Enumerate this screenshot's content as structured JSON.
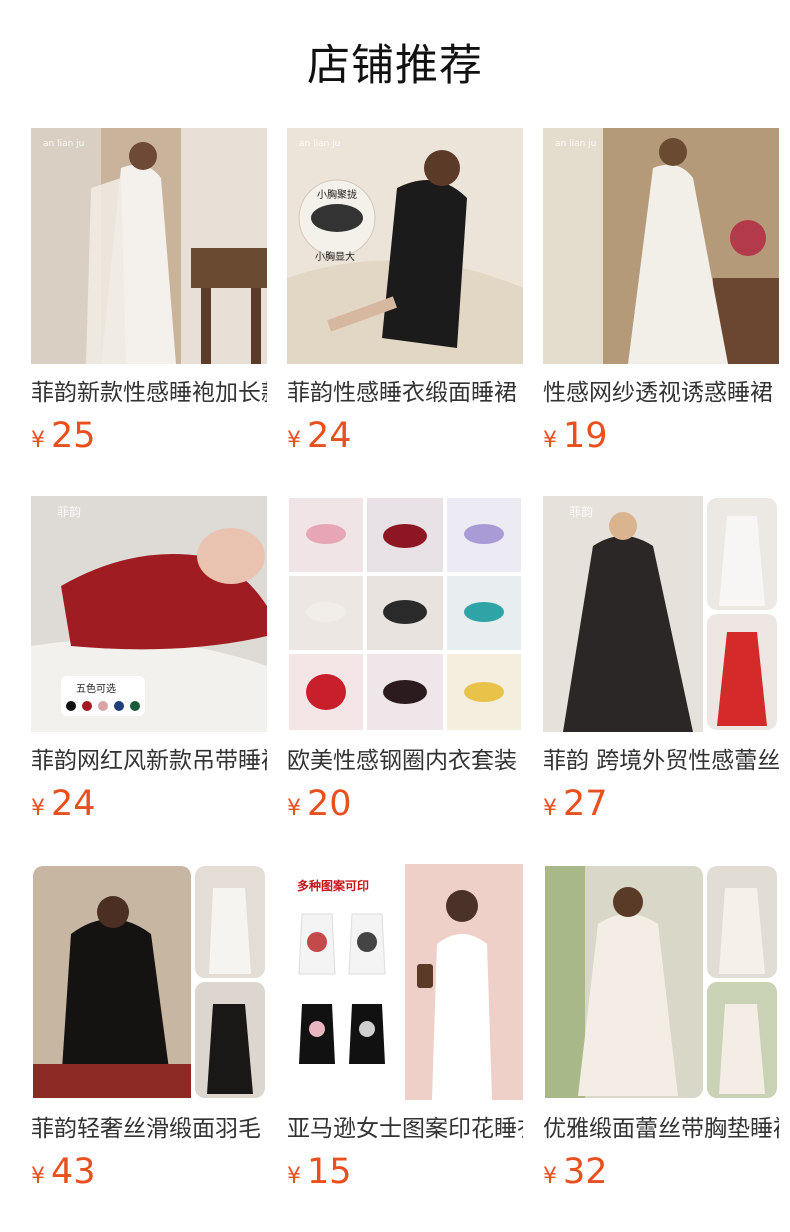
{
  "section": {
    "title": "店铺推荐"
  },
  "products": [
    {
      "name": "菲韵新款性感睡袍加长款",
      "currency": "¥",
      "price": "25",
      "image_overlay": [
        "an lian ju"
      ]
    },
    {
      "name": "菲韵性感睡衣缎面睡裙",
      "currency": "¥",
      "price": "24",
      "image_overlay": [
        "an lian ju",
        "小胸显大"
      ]
    },
    {
      "name": "性感网纱透视诱惑睡裙",
      "currency": "¥",
      "price": "19",
      "image_overlay": [
        "an lian ju"
      ]
    },
    {
      "name": "菲韵网红风新款吊带睡裙",
      "currency": "¥",
      "price": "24",
      "image_overlay": [
        "菲韵",
        "五色可选"
      ]
    },
    {
      "name": "欧美性感钢圈内衣套装",
      "currency": "¥",
      "price": "20",
      "image_overlay": []
    },
    {
      "name": "菲韵 跨境外贸性感蕾丝",
      "currency": "¥",
      "price": "27",
      "image_overlay": [
        "菲韵"
      ]
    },
    {
      "name": "菲韵轻奢丝滑缎面羽毛",
      "currency": "¥",
      "price": "43",
      "image_overlay": []
    },
    {
      "name": "亚马逊女士图案印花睡衣",
      "currency": "¥",
      "price": "15",
      "image_overlay": [
        "多种图案可印"
      ]
    },
    {
      "name": "优雅缎面蕾丝带胸垫睡裙",
      "currency": "¥",
      "price": "32",
      "image_overlay": []
    }
  ],
  "colors": {
    "price": "#e8501f",
    "title": "#111111",
    "name": "#333333"
  }
}
